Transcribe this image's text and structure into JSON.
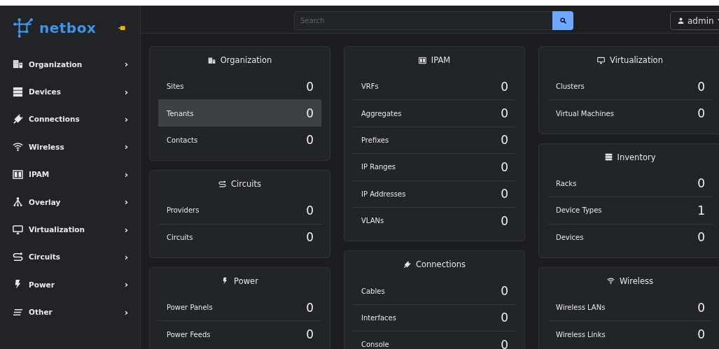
{
  "brand": "netbox",
  "sidebar": {
    "items": [
      {
        "label": "Organization",
        "chevron": "›"
      },
      {
        "label": "Devices",
        "chevron": "›"
      },
      {
        "label": "Connections",
        "chevron": "›"
      },
      {
        "label": "Wireless",
        "chevron": "›"
      },
      {
        "label": "IPAM",
        "chevron": "›"
      },
      {
        "label": "Overlay",
        "chevron": "›"
      },
      {
        "label": "Virtualization",
        "chevron": "›"
      },
      {
        "label": "Circuits",
        "chevron": "›"
      },
      {
        "label": "Power",
        "chevron": "›"
      },
      {
        "label": "Other",
        "chevron": "›"
      }
    ]
  },
  "search": {
    "placeholder": "Search"
  },
  "user": {
    "label": "admin"
  },
  "columns": [
    [
      {
        "title": "Organization",
        "rows": [
          {
            "label": "Sites",
            "count": "0",
            "selected": false
          },
          {
            "label": "Tenants",
            "count": "0",
            "selected": true
          },
          {
            "label": "Contacts",
            "count": "0",
            "selected": false
          }
        ]
      },
      {
        "title": "Circuits",
        "rows": [
          {
            "label": "Providers",
            "count": "0",
            "selected": false
          },
          {
            "label": "Circuits",
            "count": "0",
            "selected": false
          }
        ]
      },
      {
        "title": "Power",
        "rows": [
          {
            "label": "Power Panels",
            "count": "0",
            "selected": false
          },
          {
            "label": "Power Feeds",
            "count": "0",
            "selected": false
          }
        ]
      }
    ],
    [
      {
        "title": "IPAM",
        "rows": [
          {
            "label": "VRFs",
            "count": "0",
            "selected": false
          },
          {
            "label": "Aggregates",
            "count": "0",
            "selected": false
          },
          {
            "label": "Prefixes",
            "count": "0",
            "selected": false
          },
          {
            "label": "IP Ranges",
            "count": "0",
            "selected": false
          },
          {
            "label": "IP Addresses",
            "count": "0",
            "selected": false
          },
          {
            "label": "VLANs",
            "count": "0",
            "selected": false
          }
        ]
      },
      {
        "title": "Connections",
        "rows": [
          {
            "label": "Cables",
            "count": "0",
            "selected": false
          },
          {
            "label": "Interfaces",
            "count": "0",
            "selected": false
          },
          {
            "label": "Console",
            "count": "0",
            "selected": false
          }
        ]
      }
    ],
    [
      {
        "title": "Virtualization",
        "rows": [
          {
            "label": "Clusters",
            "count": "0",
            "selected": false
          },
          {
            "label": "Virtual Machines",
            "count": "0",
            "selected": false
          }
        ]
      },
      {
        "title": "Inventory",
        "rows": [
          {
            "label": "Racks",
            "count": "0",
            "selected": false
          },
          {
            "label": "Device Types",
            "count": "1",
            "selected": false
          },
          {
            "label": "Devices",
            "count": "0",
            "selected": false
          }
        ]
      },
      {
        "title": "Wireless",
        "rows": [
          {
            "label": "Wireless LANs",
            "count": "0",
            "selected": false
          },
          {
            "label": "Wireless Links",
            "count": "0",
            "selected": false
          }
        ]
      }
    ]
  ]
}
